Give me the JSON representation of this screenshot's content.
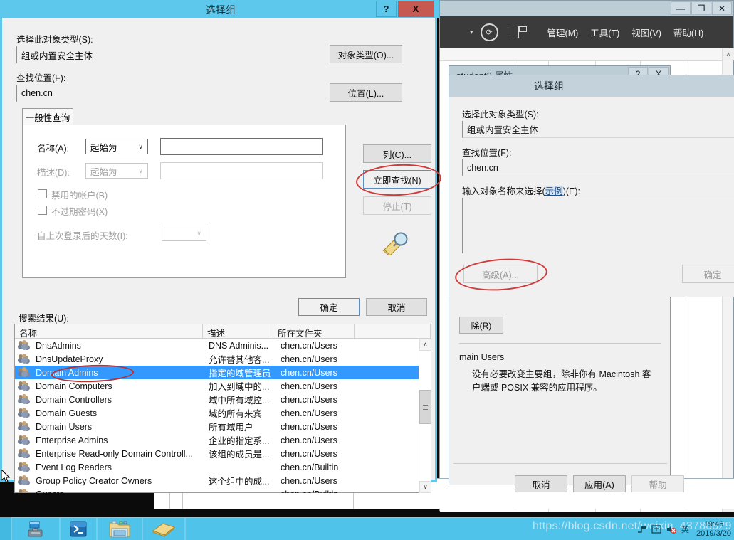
{
  "server_manager": {
    "window_name": "server-manager",
    "sys_buttons": [
      "—",
      "❐",
      "✕"
    ],
    "menu": [
      {
        "label": "管理(M)",
        "accel": "M"
      },
      {
        "label": "工具(T)",
        "accel": "T"
      },
      {
        "label": "视图(V)",
        "accel": "V"
      },
      {
        "label": "帮助(H)",
        "accel": "H"
      }
    ],
    "refresh_icon": "refresh-icon",
    "flag_icon": "notifications-flag-icon",
    "caret_icon": "chevron-down-icon"
  },
  "student_properties": {
    "title": "student2 属性",
    "help_button": "?",
    "close_button": "X",
    "remove_button": "除(R)",
    "primary_group_value": "main Users",
    "primary_group_note": "没有必要改变主要组，除非你有 Macintosh 客户端或 POSIX 兼容的应用程序。",
    "buttons": [
      {
        "label": "取消",
        "disabled": false
      },
      {
        "label": "应用(A)",
        "disabled": false
      },
      {
        "label": "帮助",
        "disabled": true
      }
    ]
  },
  "select_group_right": {
    "title": "选择组",
    "object_type_label": "选择此对象类型(S):",
    "object_type_value": "组或内置安全主体",
    "location_label": "查找位置(F):",
    "location_value": "chen.cn",
    "names_label_prefix": "输入对象名称来选择(",
    "names_label_link": "示例",
    "names_label_suffix": ")(E):",
    "names_value": "",
    "advanced_button": "高级(A)...",
    "ok_button": "确定"
  },
  "select_group_left": {
    "title": "选择组",
    "help_button": "?",
    "close_button": "X",
    "object_type_label": "选择此对象类型(S):",
    "object_type_value": "组或内置安全主体",
    "object_type_button": "对象类型(O)...",
    "location_label": "查找位置(F):",
    "location_value": "chen.cn",
    "location_button": "位置(L)...",
    "tab_label": "一般性查询",
    "query": {
      "name_label": "名称(A):",
      "name_operator": "起始为",
      "name_value": "",
      "desc_label": "描述(D):",
      "desc_operator": "起始为",
      "desc_value": "",
      "disabled_accounts_label": "禁用的帐户(B)",
      "disabled_accounts_checked": false,
      "non_expiring_pw_label": "不过期密码(X)",
      "non_expiring_pw_checked": false,
      "days_since_logon_label": "自上次登录后的天数(I):",
      "days_since_logon_value": ""
    },
    "buttons": {
      "columns": "列(C)...",
      "find_now": "立即查找(N)",
      "stop": "停止(T)",
      "ok": "确定",
      "cancel": "取消"
    },
    "magnifier_icon": "magnifier-icon",
    "results_label": "搜索结果(U):",
    "results_columns": [
      "名称",
      "描述",
      "所在文件夹"
    ],
    "results_rows": [
      {
        "name": "DnsAdmins",
        "desc": "DNS Adminis...",
        "folder": "chen.cn/Users",
        "selected": false
      },
      {
        "name": "DnsUpdateProxy",
        "desc": "允许替其他客...",
        "folder": "chen.cn/Users",
        "selected": false
      },
      {
        "name": "Domain Admins",
        "desc": "指定的域管理员",
        "folder": "chen.cn/Users",
        "selected": true
      },
      {
        "name": "Domain Computers",
        "desc": "加入到域中的...",
        "folder": "chen.cn/Users",
        "selected": false
      },
      {
        "name": "Domain Controllers",
        "desc": "域中所有域控...",
        "folder": "chen.cn/Users",
        "selected": false
      },
      {
        "name": "Domain Guests",
        "desc": "域的所有来宾",
        "folder": "chen.cn/Users",
        "selected": false
      },
      {
        "name": "Domain Users",
        "desc": "所有域用户",
        "folder": "chen.cn/Users",
        "selected": false
      },
      {
        "name": "Enterprise Admins",
        "desc": "企业的指定系...",
        "folder": "chen.cn/Users",
        "selected": false
      },
      {
        "name": "Enterprise Read-only Domain Controll...",
        "desc": "该组的成员是...",
        "folder": "chen.cn/Users",
        "selected": false
      },
      {
        "name": "Event Log Readers",
        "desc": "",
        "folder": "chen.cn/Builtin",
        "selected": false
      },
      {
        "name": "Group Policy Creator Owners",
        "desc": "这个组中的成...",
        "folder": "chen.cn/Users",
        "selected": false
      },
      {
        "name": "Guests",
        "desc": "",
        "folder": "chen.cn/Builtin",
        "selected": false
      }
    ]
  },
  "taskbar": {
    "items": [
      "server-manager-icon",
      "powershell-icon",
      "file-explorer-icon",
      "books-icon"
    ],
    "tray_icons": [
      "network-icon",
      "ime-icon",
      "volume-muted-icon",
      "ime-lang-icon"
    ],
    "clock_time": "19:46",
    "clock_date": "2019/3/20",
    "watermark": "https://blog.csdn.net/weixin_43780829"
  },
  "colors": {
    "active_title": "#5ec8ec",
    "inactive_title": "#bdcdd6",
    "close_red": "#c65a52",
    "selection_blue": "#3399ff",
    "annotation_red": "#d03a3a",
    "taskbar": "#4fc3ea",
    "toolbar_dark": "#3b3b3b"
  }
}
